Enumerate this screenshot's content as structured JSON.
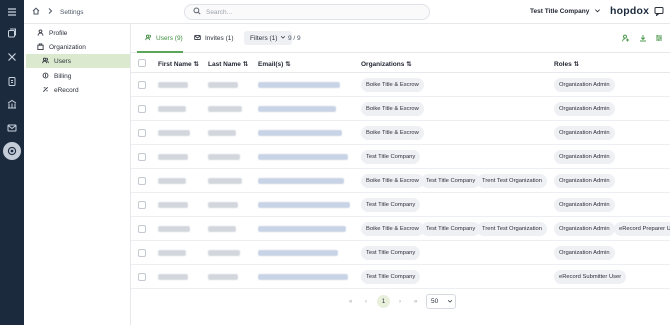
{
  "breadcrumb": {
    "page": "Settings"
  },
  "search": {
    "placeholder": "Search..."
  },
  "header": {
    "company": "Test Title Company",
    "logo": "hopdox"
  },
  "sidebar": {
    "items": [
      {
        "label": "Profile",
        "icon": "user-icon"
      },
      {
        "label": "Organization",
        "icon": "building-icon"
      },
      {
        "label": "Users",
        "icon": "users-icon",
        "selected": true
      },
      {
        "label": "Billing",
        "icon": "billing-icon"
      },
      {
        "label": "eRecord",
        "icon": "erecord-icon"
      }
    ]
  },
  "tabs": {
    "users": "Users (9)",
    "invites": "Invites (1)",
    "filters": "Filters (1)",
    "count": "9 / 9"
  },
  "table": {
    "columns": [
      "First Name",
      "Last Name",
      "Email(s)",
      "Organizations",
      "Roles"
    ],
    "rows": [
      {
        "orgs": [
          "Boike Title & Escrow"
        ],
        "roles": [
          "Organization Admin"
        ]
      },
      {
        "orgs": [
          "Boike Title & Escrow"
        ],
        "roles": [
          "Organization Admin"
        ]
      },
      {
        "orgs": [
          "Boike Title & Escrow"
        ],
        "roles": [
          "Organization Admin"
        ]
      },
      {
        "orgs": [
          "Test Title Company"
        ],
        "roles": [
          "Organization Admin"
        ]
      },
      {
        "orgs": [
          "Boike Title & Escrow",
          "Test Title Company",
          "Trent Test Organization"
        ],
        "roles": [
          "Organization Admin"
        ]
      },
      {
        "orgs": [
          "Test Title Company"
        ],
        "roles": [
          "Organization Admin"
        ]
      },
      {
        "orgs": [
          "Boike Title & Escrow",
          "Test Title Company",
          "Trent Test Organization"
        ],
        "roles": [
          "Organization Admin",
          "eRecord Preparer User"
        ]
      },
      {
        "orgs": [
          "Test Title Company"
        ],
        "roles": [
          "Organization Admin"
        ]
      },
      {
        "orgs": [
          "Test Title Company"
        ],
        "roles": [
          "eRecord Submitter User"
        ]
      }
    ]
  },
  "pagination": {
    "current": "1",
    "per_page": "50"
  },
  "colors": {
    "rail": "#1c2a3d",
    "accent": "#5aa55a",
    "selected_bg": "#dbe9cf"
  }
}
